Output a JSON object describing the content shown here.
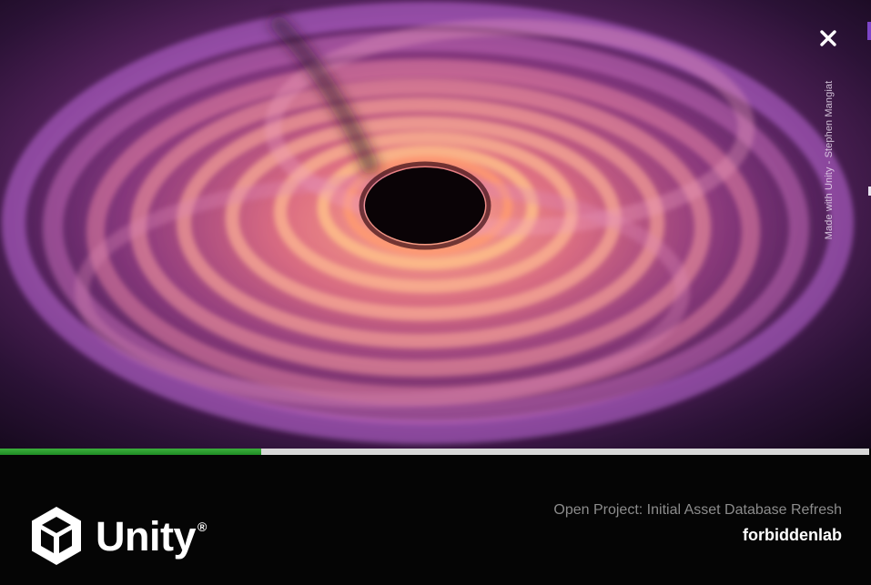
{
  "splash": {
    "credit": "Made with Unity - Stephen Mangiat",
    "close_icon": "close-icon"
  },
  "progress": {
    "fraction": 0.3,
    "color": "#2fa032",
    "track_color": "#d7d7d7"
  },
  "footer": {
    "brand": "Unity",
    "registered": "®",
    "logo_icon": "unity-cube-icon",
    "status": "Open Project: Initial Asset Database Refresh",
    "project_name": "forbiddenlab"
  }
}
